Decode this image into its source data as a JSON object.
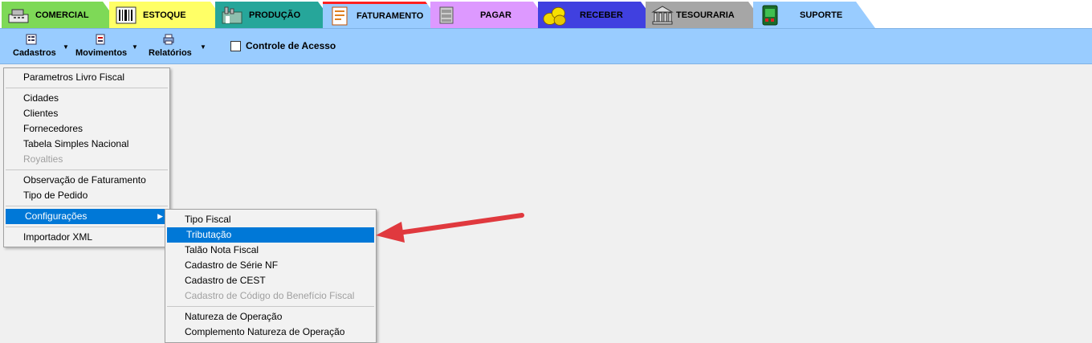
{
  "tabs": [
    {
      "label": "COMERCIAL",
      "icon": "cash-register-icon",
      "color": "#7ed957"
    },
    {
      "label": "ESTOQUE",
      "icon": "barcode-icon",
      "color": "#ffff66"
    },
    {
      "label": "PRODUÇÃO",
      "icon": "factory-icon",
      "color": "#26a69a"
    },
    {
      "label": "FATURAMENTO",
      "icon": "invoice-icon",
      "color": "#99ccff",
      "active": true
    },
    {
      "label": "PAGAR",
      "icon": "money-stack-icon",
      "color": "#dd99ff"
    },
    {
      "label": "RECEBER",
      "icon": "coins-icon",
      "color": "#4040e0"
    },
    {
      "label": "TESOURARIA",
      "icon": "bank-icon",
      "color": "#a6a6a6"
    },
    {
      "label": "SUPORTE",
      "icon": "support-device-icon",
      "color": "#99ccff"
    }
  ],
  "toolbar": {
    "cadastros": "Cadastros",
    "movimentos": "Movimentos",
    "relatorios": "Relatórios",
    "controle_acesso": "Controle de Acesso"
  },
  "cadastros_menu": {
    "parametros": "Parametros Livro Fiscal",
    "cidades": "Cidades",
    "clientes": "Clientes",
    "fornecedores": "Fornecedores",
    "tabela_simples": "Tabela Simples Nacional",
    "royalties": "Royalties",
    "observacao": "Observação de Faturamento",
    "tipo_pedido": "Tipo de Pedido",
    "configuracoes": "Configurações",
    "importador": "Importador XML"
  },
  "config_menu": {
    "tipo_fiscal": "Tipo Fiscal",
    "tributacao": "Tributação",
    "talao": "Talão Nota Fiscal",
    "serie_nf": "Cadastro de Série NF",
    "cest": "Cadastro de CEST",
    "beneficio": "Cadastro de Código do Benefício Fiscal",
    "natureza": "Natureza de Operação",
    "complemento": "Complemento Natureza de Operação"
  },
  "colors": {
    "highlight": "#0078d7",
    "toolbar": "#99ccff",
    "arrow": "#e0393e"
  }
}
